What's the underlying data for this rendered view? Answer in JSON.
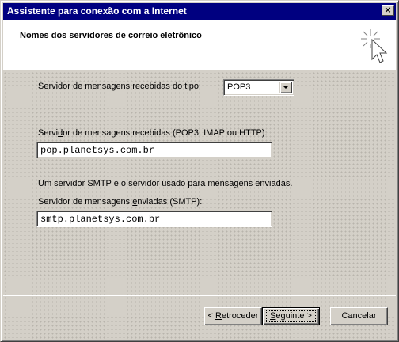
{
  "window": {
    "title": "Assistente para conexão com a Internet",
    "close_glyph": "×"
  },
  "header": {
    "title": "Nomes dos servidores de correio eletrônico",
    "icon": "wizard-sparkle-cursor-icon"
  },
  "form": {
    "incoming_type_label": "Servidor de mensagens recebidas do tipo",
    "incoming_type_value": "POP3",
    "incoming_server_label_pre": "Servi",
    "incoming_server_label_accel": "d",
    "incoming_server_label_post": "or de mensagens recebidas (POP3, IMAP ou HTTP):",
    "incoming_server_value": "pop.planetsys.com.br",
    "smtp_description": "Um servidor SMTP é o servidor usado para mensagens enviadas.",
    "outgoing_server_label_pre": "Servidor de mensagens ",
    "outgoing_server_label_accel": "e",
    "outgoing_server_label_post": "nviadas (SMTP):",
    "outgoing_server_value": "smtp.planetsys.com.br"
  },
  "buttons": {
    "back_pre": "< ",
    "back_accel": "R",
    "back_post": "etroceder",
    "next_accel": "S",
    "next_post": "eguinte >",
    "cancel": "Cancelar"
  },
  "colors": {
    "titlebar": "#000080",
    "face": "#d4d0c8"
  }
}
